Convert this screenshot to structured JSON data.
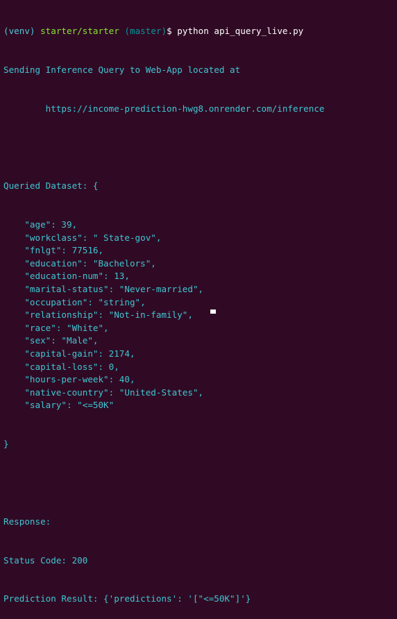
{
  "prompt": {
    "venv": "(venv)",
    "path": "starter/starter",
    "branch": "(master)",
    "symbol": "$",
    "command": "python api_query_live.py"
  },
  "output": {
    "sending": "Sending Inference Query to Web-App located at",
    "url": "        https://income-prediction-hwg8.onrender.com/inference",
    "queried_header": "Queried Dataset: {",
    "fields": [
      "    \"age\": 39,",
      "    \"workclass\": \" State-gov\",",
      "    \"fnlgt\": 77516,",
      "    \"education\": \"Bachelors\",",
      "    \"education-num\": 13,",
      "    \"marital-status\": \"Never-married\",",
      "    \"occupation\": \"string\",",
      "    \"relationship\": \"Not-in-family\",",
      "    \"race\": \"White\",",
      "    \"sex\": \"Male\",",
      "    \"capital-gain\": 2174,",
      "    \"capital-loss\": 0,",
      "    \"hours-per-week\": 40,",
      "    \"native-country\": \"United-States\",",
      "    \"salary\": \"<=50K\""
    ],
    "closing": "}",
    "response": "Response:",
    "status": "Status Code: 200",
    "prediction": "Prediction Result: {'predictions': '[\"<=50K\"]'}"
  },
  "colors": {
    "background": "#300a24",
    "text": "#3fc6d3",
    "path": "#8ae234",
    "branch": "#06989a"
  }
}
